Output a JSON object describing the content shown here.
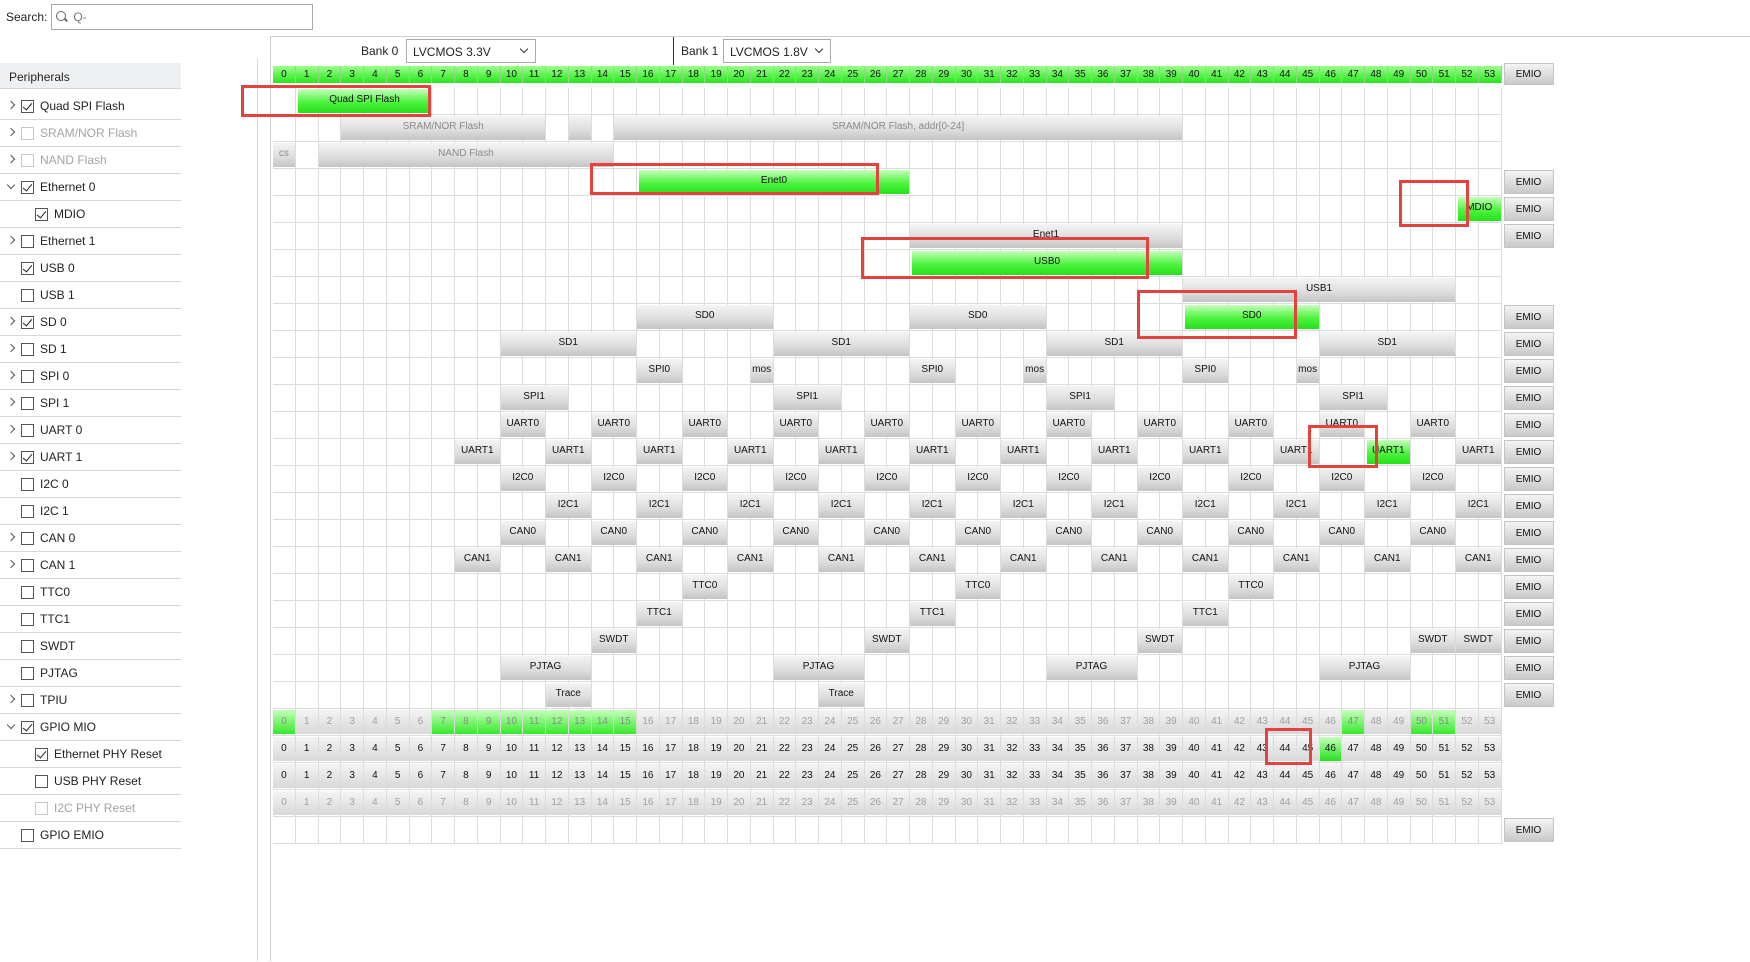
{
  "search": {
    "label": "Search:",
    "placeholder": "Q-",
    "value": ""
  },
  "peripherals_header": "Peripherals",
  "tree": [
    {
      "label": "Quad SPI Flash",
      "expander": "right",
      "checked": true,
      "disabled": false,
      "indent": 0
    },
    {
      "label": "SRAM/NOR Flash",
      "expander": "right",
      "checked": false,
      "disabled": true,
      "indent": 0
    },
    {
      "label": "NAND Flash",
      "expander": "right",
      "checked": false,
      "disabled": true,
      "indent": 0
    },
    {
      "label": "Ethernet 0",
      "expander": "down",
      "checked": true,
      "disabled": false,
      "indent": 0
    },
    {
      "label": "MDIO",
      "expander": "none",
      "checked": true,
      "disabled": false,
      "indent": 1
    },
    {
      "label": "Ethernet 1",
      "expander": "right",
      "checked": false,
      "disabled": false,
      "indent": 0
    },
    {
      "label": "USB 0",
      "expander": "none",
      "checked": true,
      "disabled": false,
      "indent": 0
    },
    {
      "label": "USB 1",
      "expander": "none",
      "checked": false,
      "disabled": false,
      "indent": 0
    },
    {
      "label": "SD 0",
      "expander": "right",
      "checked": true,
      "disabled": false,
      "indent": 0
    },
    {
      "label": "SD 1",
      "expander": "right",
      "checked": false,
      "disabled": false,
      "indent": 0
    },
    {
      "label": "SPI 0",
      "expander": "right",
      "checked": false,
      "disabled": false,
      "indent": 0
    },
    {
      "label": "SPI 1",
      "expander": "right",
      "checked": false,
      "disabled": false,
      "indent": 0
    },
    {
      "label": "UART 0",
      "expander": "right",
      "checked": false,
      "disabled": false,
      "indent": 0
    },
    {
      "label": "UART 1",
      "expander": "right",
      "checked": true,
      "disabled": false,
      "indent": 0
    },
    {
      "label": "I2C 0",
      "expander": "none",
      "checked": false,
      "disabled": false,
      "indent": 0
    },
    {
      "label": "I2C 1",
      "expander": "none",
      "checked": false,
      "disabled": false,
      "indent": 0
    },
    {
      "label": "CAN 0",
      "expander": "right",
      "checked": false,
      "disabled": false,
      "indent": 0
    },
    {
      "label": "CAN 1",
      "expander": "right",
      "checked": false,
      "disabled": false,
      "indent": 0
    },
    {
      "label": "TTC0",
      "expander": "none",
      "checked": false,
      "disabled": false,
      "indent": 0
    },
    {
      "label": "TTC1",
      "expander": "none",
      "checked": false,
      "disabled": false,
      "indent": 0
    },
    {
      "label": "SWDT",
      "expander": "none",
      "checked": false,
      "disabled": false,
      "indent": 0
    },
    {
      "label": "PJTAG",
      "expander": "none",
      "checked": false,
      "disabled": false,
      "indent": 0
    },
    {
      "label": "TPIU",
      "expander": "right",
      "checked": false,
      "disabled": false,
      "indent": 0
    },
    {
      "label": "GPIO MIO",
      "expander": "down",
      "checked": true,
      "disabled": false,
      "indent": 0
    },
    {
      "label": "Ethernet PHY Reset",
      "expander": "none",
      "checked": true,
      "disabled": false,
      "indent": 1
    },
    {
      "label": "USB PHY Reset",
      "expander": "none",
      "checked": false,
      "disabled": false,
      "indent": 1
    },
    {
      "label": "I2C PHY Reset",
      "expander": "none",
      "checked": false,
      "disabled": true,
      "indent": 1
    },
    {
      "label": "GPIO EMIO",
      "expander": "none",
      "checked": false,
      "disabled": false,
      "indent": 0
    }
  ],
  "bank0": {
    "label": "Bank 0",
    "value": "LVCMOS 3.3V"
  },
  "bank1": {
    "label": "Bank 1",
    "value": "LVCMOS 1.8V"
  },
  "emio_label": "EMIO",
  "pin_numbers": [
    "0",
    "1",
    "2",
    "3",
    "4",
    "5",
    "6",
    "7",
    "8",
    "9",
    "10",
    "11",
    "12",
    "13",
    "14",
    "15",
    "16",
    "17",
    "18",
    "19",
    "20",
    "21",
    "22",
    "23",
    "24",
    "25",
    "26",
    "27",
    "28",
    "29",
    "30",
    "31",
    "32",
    "33",
    "34",
    "35",
    "36",
    "37",
    "38",
    "39",
    "40",
    "41",
    "42",
    "43",
    "44",
    "45",
    "46",
    "47",
    "48",
    "49",
    "50",
    "51",
    "52",
    "53"
  ],
  "rows": [
    {
      "emio": false,
      "bars": [
        {
          "start": 1,
          "span": 6,
          "label": "Quad SPI Flash",
          "green": true
        }
      ]
    },
    {
      "emio": false,
      "bars": [
        {
          "start": 3,
          "span": 9,
          "label": "SRAM/NOR Flash",
          "gray": true
        },
        {
          "start": 13,
          "span": 1,
          "label": "",
          "gray": true
        },
        {
          "start": 15,
          "span": 25,
          "label": "SRAM/NOR Flash, addr[0-24]",
          "gray": true
        }
      ]
    },
    {
      "emio": false,
      "bars": [
        {
          "start": 0,
          "span": 1,
          "label": "cs",
          "gray": true
        },
        {
          "start": 2,
          "span": 13,
          "label": "NAND Flash",
          "gray": true
        }
      ]
    },
    {
      "emio": true,
      "bars": [
        {
          "start": 16,
          "span": 12,
          "label": "Enet0",
          "green": true
        }
      ]
    },
    {
      "emio": true,
      "bars": [
        {
          "start": 52,
          "span": 2,
          "label": "MDIO",
          "green": true
        }
      ]
    },
    {
      "emio": true,
      "bars": [
        {
          "start": 28,
          "span": 12,
          "label": "Enet1"
        }
      ]
    },
    {
      "emio": false,
      "bars": [
        {
          "start": 28,
          "span": 12,
          "label": "USB0",
          "green": true
        }
      ]
    },
    {
      "emio": false,
      "bars": [
        {
          "start": 40,
          "span": 12,
          "label": "USB1"
        }
      ]
    },
    {
      "emio": true,
      "bars": [
        {
          "start": 16,
          "span": 6,
          "label": "SD0"
        },
        {
          "start": 28,
          "span": 6,
          "label": "SD0"
        },
        {
          "start": 40,
          "span": 6,
          "label": "SD0",
          "green": true
        }
      ]
    },
    {
      "emio": true,
      "bars": [
        {
          "start": 10,
          "span": 6,
          "label": "SD1"
        },
        {
          "start": 22,
          "span": 6,
          "label": "SD1"
        },
        {
          "start": 34,
          "span": 6,
          "label": "SD1"
        },
        {
          "start": 46,
          "span": 6,
          "label": "SD1"
        }
      ]
    },
    {
      "emio": true,
      "bars": [
        {
          "start": 16,
          "span": 2,
          "label": "SPI0"
        },
        {
          "start": 21,
          "span": 1,
          "label": "mos"
        },
        {
          "start": 28,
          "span": 2,
          "label": "SPI0"
        },
        {
          "start": 33,
          "span": 1,
          "label": "mos"
        },
        {
          "start": 40,
          "span": 2,
          "label": "SPI0"
        },
        {
          "start": 45,
          "span": 1,
          "label": "mos"
        }
      ]
    },
    {
      "emio": true,
      "bars": [
        {
          "start": 10,
          "span": 3,
          "label": "SPI1"
        },
        {
          "start": 22,
          "span": 3,
          "label": "SPI1"
        },
        {
          "start": 34,
          "span": 3,
          "label": "SPI1"
        },
        {
          "start": 46,
          "span": 3,
          "label": "SPI1"
        }
      ]
    },
    {
      "emio": true,
      "bars": [
        {
          "start": 10,
          "span": 2,
          "label": "UART0"
        },
        {
          "start": 14,
          "span": 2,
          "label": "UART0"
        },
        {
          "start": 18,
          "span": 2,
          "label": "UART0"
        },
        {
          "start": 22,
          "span": 2,
          "label": "UART0"
        },
        {
          "start": 26,
          "span": 2,
          "label": "UART0"
        },
        {
          "start": 30,
          "span": 2,
          "label": "UART0"
        },
        {
          "start": 34,
          "span": 2,
          "label": "UART0"
        },
        {
          "start": 38,
          "span": 2,
          "label": "UART0"
        },
        {
          "start": 42,
          "span": 2,
          "label": "UART0"
        },
        {
          "start": 46,
          "span": 2,
          "label": "UART0"
        },
        {
          "start": 50,
          "span": 2,
          "label": "UART0"
        }
      ]
    },
    {
      "emio": true,
      "bars": [
        {
          "start": 8,
          "span": 2,
          "label": "UART1"
        },
        {
          "start": 12,
          "span": 2,
          "label": "UART1"
        },
        {
          "start": 16,
          "span": 2,
          "label": "UART1"
        },
        {
          "start": 20,
          "span": 2,
          "label": "UART1"
        },
        {
          "start": 24,
          "span": 2,
          "label": "UART1"
        },
        {
          "start": 28,
          "span": 2,
          "label": "UART1"
        },
        {
          "start": 32,
          "span": 2,
          "label": "UART1"
        },
        {
          "start": 36,
          "span": 2,
          "label": "UART1"
        },
        {
          "start": 40,
          "span": 2,
          "label": "UART1"
        },
        {
          "start": 44,
          "span": 2,
          "label": "UART1"
        },
        {
          "start": 48,
          "span": 2,
          "label": "UART1",
          "green": true
        },
        {
          "start": 52,
          "span": 2,
          "label": "UART1"
        }
      ]
    },
    {
      "emio": true,
      "bars": [
        {
          "start": 10,
          "span": 2,
          "label": "I2C0"
        },
        {
          "start": 14,
          "span": 2,
          "label": "I2C0"
        },
        {
          "start": 18,
          "span": 2,
          "label": "I2C0"
        },
        {
          "start": 22,
          "span": 2,
          "label": "I2C0"
        },
        {
          "start": 26,
          "span": 2,
          "label": "I2C0"
        },
        {
          "start": 30,
          "span": 2,
          "label": "I2C0"
        },
        {
          "start": 34,
          "span": 2,
          "label": "I2C0"
        },
        {
          "start": 38,
          "span": 2,
          "label": "I2C0"
        },
        {
          "start": 42,
          "span": 2,
          "label": "I2C0"
        },
        {
          "start": 46,
          "span": 2,
          "label": "I2C0"
        },
        {
          "start": 50,
          "span": 2,
          "label": "I2C0"
        }
      ]
    },
    {
      "emio": true,
      "bars": [
        {
          "start": 12,
          "span": 2,
          "label": "I2C1"
        },
        {
          "start": 16,
          "span": 2,
          "label": "I2C1"
        },
        {
          "start": 20,
          "span": 2,
          "label": "I2C1"
        },
        {
          "start": 24,
          "span": 2,
          "label": "I2C1"
        },
        {
          "start": 28,
          "span": 2,
          "label": "I2C1"
        },
        {
          "start": 32,
          "span": 2,
          "label": "I2C1"
        },
        {
          "start": 36,
          "span": 2,
          "label": "I2C1"
        },
        {
          "start": 40,
          "span": 2,
          "label": "I2C1"
        },
        {
          "start": 44,
          "span": 2,
          "label": "I2C1"
        },
        {
          "start": 48,
          "span": 2,
          "label": "I2C1"
        },
        {
          "start": 52,
          "span": 2,
          "label": "I2C1"
        }
      ]
    },
    {
      "emio": true,
      "bars": [
        {
          "start": 10,
          "span": 2,
          "label": "CAN0"
        },
        {
          "start": 14,
          "span": 2,
          "label": "CAN0"
        },
        {
          "start": 18,
          "span": 2,
          "label": "CAN0"
        },
        {
          "start": 22,
          "span": 2,
          "label": "CAN0"
        },
        {
          "start": 26,
          "span": 2,
          "label": "CAN0"
        },
        {
          "start": 30,
          "span": 2,
          "label": "CAN0"
        },
        {
          "start": 34,
          "span": 2,
          "label": "CAN0"
        },
        {
          "start": 38,
          "span": 2,
          "label": "CAN0"
        },
        {
          "start": 42,
          "span": 2,
          "label": "CAN0"
        },
        {
          "start": 46,
          "span": 2,
          "label": "CAN0"
        },
        {
          "start": 50,
          "span": 2,
          "label": "CAN0"
        }
      ]
    },
    {
      "emio": true,
      "bars": [
        {
          "start": 8,
          "span": 2,
          "label": "CAN1"
        },
        {
          "start": 12,
          "span": 2,
          "label": "CAN1"
        },
        {
          "start": 16,
          "span": 2,
          "label": "CAN1"
        },
        {
          "start": 20,
          "span": 2,
          "label": "CAN1"
        },
        {
          "start": 24,
          "span": 2,
          "label": "CAN1"
        },
        {
          "start": 28,
          "span": 2,
          "label": "CAN1"
        },
        {
          "start": 32,
          "span": 2,
          "label": "CAN1"
        },
        {
          "start": 36,
          "span": 2,
          "label": "CAN1"
        },
        {
          "start": 40,
          "span": 2,
          "label": "CAN1"
        },
        {
          "start": 44,
          "span": 2,
          "label": "CAN1"
        },
        {
          "start": 48,
          "span": 2,
          "label": "CAN1"
        },
        {
          "start": 52,
          "span": 2,
          "label": "CAN1"
        }
      ]
    },
    {
      "emio": true,
      "bars": [
        {
          "start": 18,
          "span": 2,
          "label": "TTC0"
        },
        {
          "start": 30,
          "span": 2,
          "label": "TTC0"
        },
        {
          "start": 42,
          "span": 2,
          "label": "TTC0"
        }
      ]
    },
    {
      "emio": true,
      "bars": [
        {
          "start": 16,
          "span": 2,
          "label": "TTC1"
        },
        {
          "start": 28,
          "span": 2,
          "label": "TTC1"
        },
        {
          "start": 40,
          "span": 2,
          "label": "TTC1"
        }
      ]
    },
    {
      "emio": true,
      "bars": [
        {
          "start": 14,
          "span": 2,
          "label": "SWDT"
        },
        {
          "start": 26,
          "span": 2,
          "label": "SWDT"
        },
        {
          "start": 38,
          "span": 2,
          "label": "SWDT"
        },
        {
          "start": 50,
          "span": 2,
          "label": "SWDT"
        },
        {
          "start": 52,
          "span": 2,
          "label": "SWDT"
        }
      ]
    },
    {
      "emio": true,
      "bars": [
        {
          "start": 10,
          "span": 4,
          "label": "PJTAG"
        },
        {
          "start": 22,
          "span": 4,
          "label": "PJTAG"
        },
        {
          "start": 34,
          "span": 4,
          "label": "PJTAG"
        },
        {
          "start": 46,
          "span": 4,
          "label": "PJTAG"
        }
      ]
    },
    {
      "emio": true,
      "bars": [
        {
          "start": 12,
          "span": 2,
          "label": "Trace"
        },
        {
          "start": 24,
          "span": 2,
          "label": "Trace"
        }
      ]
    }
  ],
  "gpio_row_green": [
    0,
    7,
    8,
    9,
    10,
    11,
    12,
    13,
    14,
    15,
    47,
    50,
    51
  ],
  "gpio_selected": 46
}
